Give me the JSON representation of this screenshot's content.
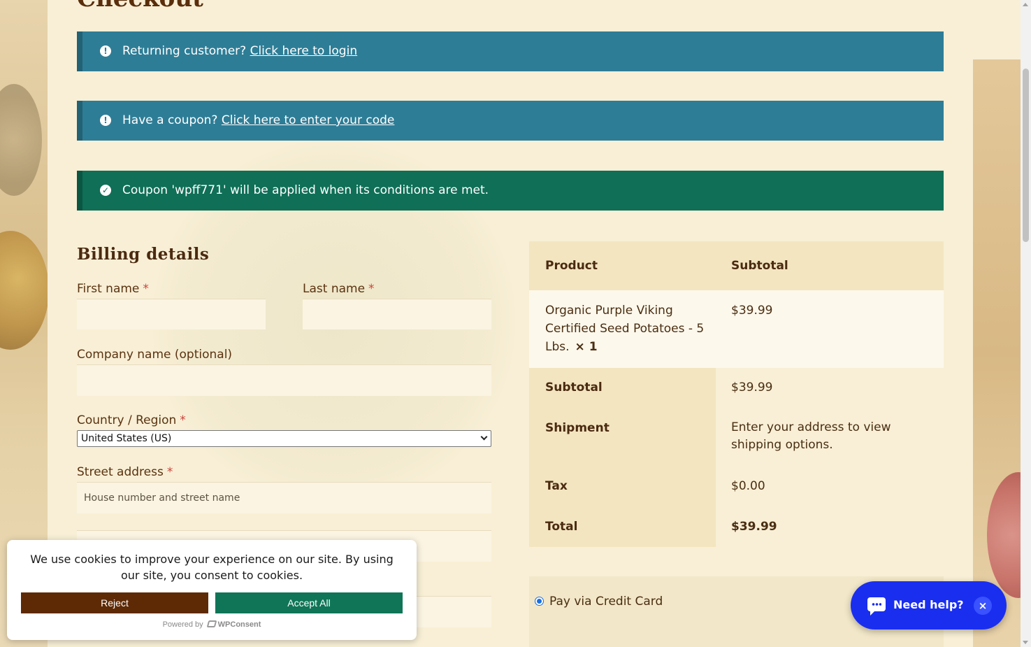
{
  "page": {
    "title": "Checkout"
  },
  "notices": {
    "login": {
      "text": "Returning customer?",
      "link": "Click here to login"
    },
    "coupon": {
      "text": "Have a coupon?",
      "link": "Click here to enter your code"
    },
    "applied": {
      "text": "Coupon 'wpff771' will be applied when its conditions are met."
    }
  },
  "billing": {
    "title": "Billing details",
    "required_mark": "*",
    "first_name_label": "First name",
    "first_name_value": "",
    "last_name_label": "Last name",
    "last_name_value": "",
    "company_label": "Company name (optional)",
    "company_value": "",
    "country_label": "Country / Region",
    "country_value": "United States (US)",
    "street_label": "Street address",
    "street_placeholder": "House number and street name",
    "street_value": ""
  },
  "order": {
    "headers": {
      "product": "Product",
      "subtotal": "Subtotal"
    },
    "item": {
      "name": "Organic Purple Viking Certified Seed Potatoes - 5 Lbs.",
      "qty": "× 1",
      "price": "$39.99"
    },
    "subtotal_label": "Subtotal",
    "subtotal_value": "$39.99",
    "shipment_label": "Shipment",
    "shipment_value": "Enter your address to view shipping options.",
    "tax_label": "Tax",
    "tax_value": "$0.00",
    "total_label": "Total",
    "total_value": "$39.99"
  },
  "payment": {
    "method_label": "Pay via Credit Card"
  },
  "cookie": {
    "text": "We use cookies to improve your experience on our site. By using our site, you consent to cookies.",
    "reject_label": "Reject",
    "accept_label": "Accept All",
    "powered_by": "Powered by",
    "brand": "WPConsent"
  },
  "chat": {
    "label": "Need help?",
    "close": "×"
  },
  "icons": {
    "info": "exclamation-circle-icon",
    "success": "check-circle-icon",
    "chat": "chat-bubble-icon",
    "close": "close-icon"
  },
  "colors": {
    "info_notice": "#2e7d96",
    "success_notice": "#0f6f57",
    "reject_button": "#5e2a06",
    "accept_button": "#0f7556",
    "chat_widget": "#1a2ef0",
    "required": "#c9463d"
  }
}
